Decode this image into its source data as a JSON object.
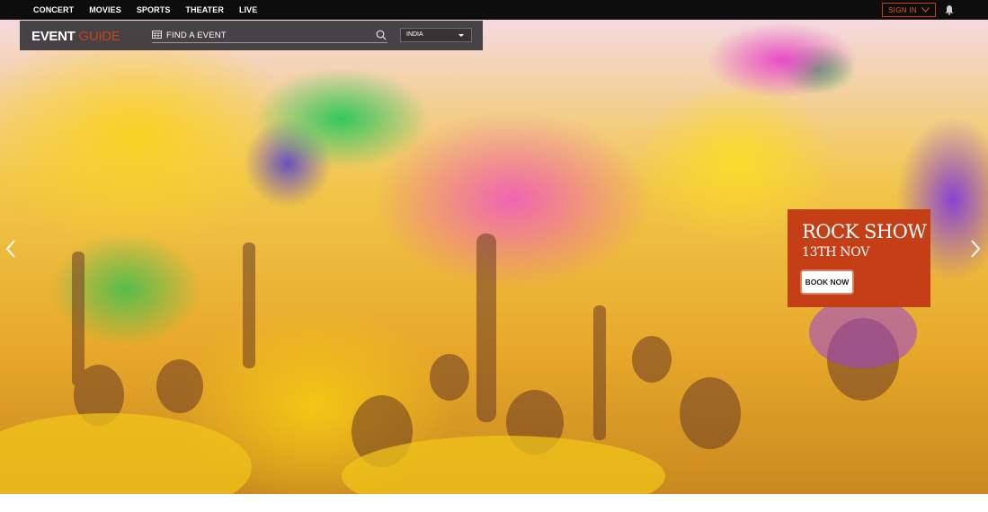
{
  "nav": {
    "items": [
      "CONCERT",
      "MOVIES",
      "SPORTS",
      "THEATER",
      "LIVE"
    ],
    "sign_in": "SIGN IN",
    "accent_color": "#c7401a"
  },
  "header": {
    "logo_primary": "EVENT",
    "logo_secondary": "GUIDE",
    "search_placeholder": "FIND A EVENT",
    "country_selected": "INDIA"
  },
  "hero": {
    "promo_title": "ROCK SHOW",
    "promo_date": "13TH NOV",
    "promo_button": "BOOK NOW",
    "promo_color": "#c53f16"
  },
  "icons": [
    "calendar-icon",
    "search-icon",
    "chevron-down-icon",
    "bell-icon",
    "arrow-left-icon",
    "arrow-right-icon"
  ]
}
